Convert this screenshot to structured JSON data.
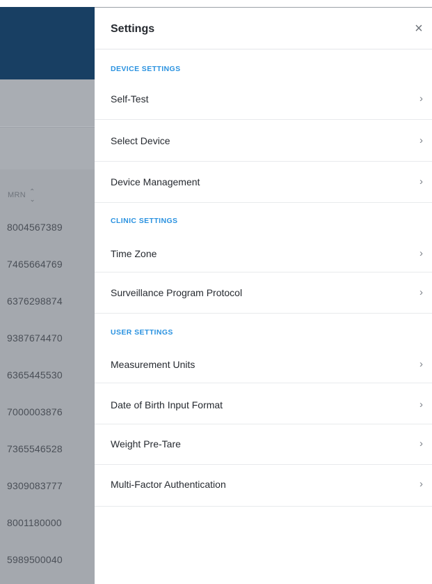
{
  "background": {
    "table": {
      "mrn_header": "MRN",
      "rows": [
        "8004567389",
        "7465664769",
        "6376298874",
        "9387674470",
        "6365445530",
        "7000003876",
        "7365546528",
        "9309083777",
        "8001180000",
        "5989500040"
      ]
    }
  },
  "settings": {
    "title": "Settings",
    "close_icon": "×",
    "chevron_icon": "›",
    "sections": [
      {
        "label": "DEVICE SETTINGS",
        "items": [
          "Self-Test",
          "Select Device",
          "Device Management"
        ]
      },
      {
        "label": "CLINIC SETTINGS",
        "items": [
          "Time Zone",
          "Surveillance Program Protocol"
        ]
      },
      {
        "label": "USER SETTINGS",
        "items": [
          "Measurement Units",
          "Date of Birth Input Format",
          "Weight Pre-Tare",
          "Multi-Factor Authentication"
        ]
      }
    ]
  },
  "colors": {
    "header_navy": "#183f63",
    "overlay_gray": "#9ea3ab",
    "section_blue": "#2a92e0"
  }
}
